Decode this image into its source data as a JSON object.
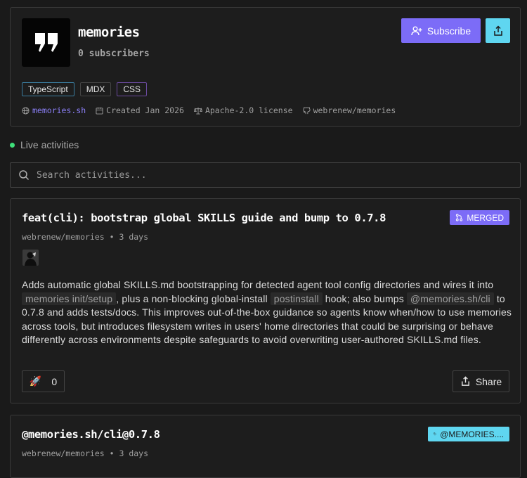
{
  "header": {
    "title": "memories",
    "subscribers": "0 subscribers",
    "subscribe_label": "Subscribe",
    "tags": [
      "TypeScript",
      "MDX",
      "CSS"
    ],
    "meta": {
      "website": "memories.sh",
      "created": "Created Jan 2026",
      "license": "Apache-2.0 license",
      "repo": "webrenew/memories"
    }
  },
  "live": {
    "label": "Live activities"
  },
  "search": {
    "placeholder": "Search activities..."
  },
  "activities": [
    {
      "title": "feat(cli): bootstrap global SKILLS guide and bump to 0.7.8",
      "meta": "webrenew/memories • 3 days",
      "badge": "MERGED",
      "body": {
        "t1": "Adds automatic global SKILLS.md bootstrapping for detected agent tool config directories and wires it into ",
        "c1": "memories init/setup",
        "t2": ", plus a non-blocking global-install ",
        "c2": "postinstall",
        "t3": " hook; also bumps ",
        "c3": "@memories.sh/cli",
        "t4": " to 0.7.8 and adds tests/docs. This improves out-of-the-box guidance so agents know when/how to use memories across tools, but introduces filesystem writes in users' home directories that could be surprising or behave differently across environments despite safeguards to avoid overwriting user-authored SKILLS.md files."
      },
      "reaction_count": "0",
      "share_label": "Share"
    },
    {
      "title": "@memories.sh/cli@0.7.8",
      "meta": "webrenew/memories • 3 days",
      "badge": "@MEMORIES...."
    }
  ],
  "colors": {
    "accent_purple": "#7c6cf7",
    "accent_cyan": "#5fd6f0",
    "live_green": "#3ee07a"
  }
}
